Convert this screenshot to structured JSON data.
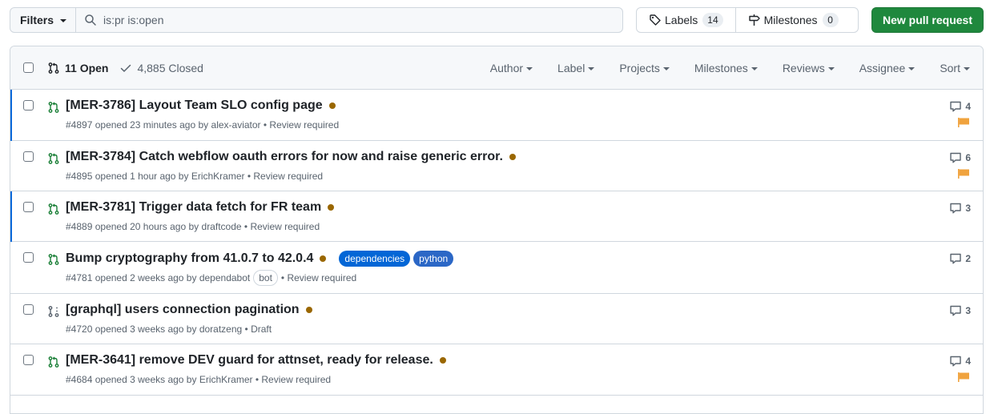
{
  "toolbar": {
    "filters_label": "Filters",
    "search_value": "is:pr is:open",
    "labels_label": "Labels",
    "labels_count": "14",
    "milestones_label": "Milestones",
    "milestones_count": "0",
    "new_pr_label": "New pull request"
  },
  "header": {
    "open_label": "11 Open",
    "closed_label": "4,885 Closed",
    "menus": [
      "Author",
      "Label",
      "Projects",
      "Milestones",
      "Reviews",
      "Assignee",
      "Sort"
    ]
  },
  "rows": [
    {
      "title": "[MER-3786] Layout Team SLO config page",
      "number": "#4897",
      "opened": "opened 23 minutes ago by",
      "author": "alex-aviator",
      "status": "• Review required",
      "comments": "4"
    },
    {
      "title": "[MER-3784] Catch webflow oauth errors for now and raise generic error.",
      "number": "#4895",
      "opened": "opened 1 hour ago by",
      "author": "ErichKramer",
      "status": "• Review required",
      "comments": "6"
    },
    {
      "title": "[MER-3781] Trigger data fetch for FR team",
      "number": "#4889",
      "opened": "opened 20 hours ago by",
      "author": "draftcode",
      "status": "• Review required",
      "comments": "3"
    },
    {
      "title": "Bump cryptography from 41.0.7 to 42.0.4",
      "number": "#4781",
      "opened": "opened 2 weeks ago by",
      "author": "dependabot",
      "bot": "bot",
      "status": "• Review required",
      "comments": "2",
      "labels": [
        "dependencies",
        "python"
      ]
    },
    {
      "title": "[graphql] users connection pagination",
      "number": "#4720",
      "opened": "opened 3 weeks ago by",
      "author": "doratzeng",
      "status": "• Draft",
      "comments": "3"
    },
    {
      "title": "[MER-3641] remove DEV guard for attnset, ready for release.",
      "number": "#4684",
      "opened": "opened 3 weeks ago by",
      "author": "ErichKramer",
      "status": "• Review required",
      "comments": "4"
    }
  ],
  "colors": {
    "accent_green": "#1f883d",
    "open_icon": "#1a7f37",
    "pending_dot": "#9a6700",
    "flag": "#f0a33e",
    "unread_bar": "#0969da"
  }
}
